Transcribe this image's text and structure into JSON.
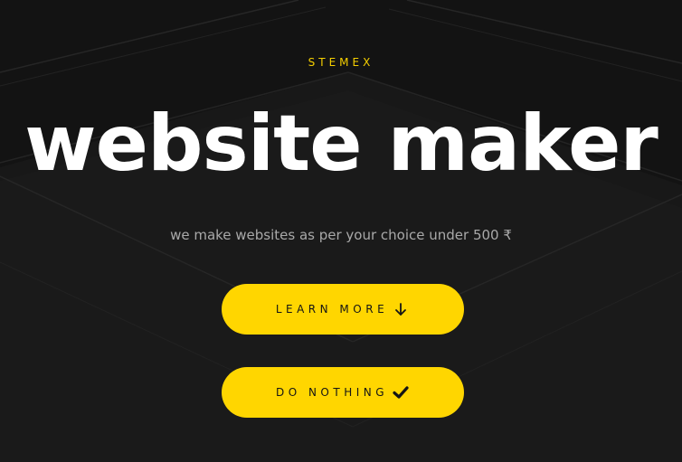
{
  "hero": {
    "eyebrow": "STEMEX",
    "headline": "website maker",
    "subtitle": "we make websites as per your choice under 500 ₹"
  },
  "buttons": {
    "learn_more": {
      "label": "LEARN MORE",
      "icon": "arrow-down-icon"
    },
    "do_nothing": {
      "label": "DO NOTHING",
      "icon": "checkmark-icon"
    }
  },
  "colors": {
    "background": "#131313",
    "accent": "#ffd600",
    "eyebrow": "#f5cf00",
    "headline": "#ffffff",
    "subtitle": "#a9a9a9"
  }
}
